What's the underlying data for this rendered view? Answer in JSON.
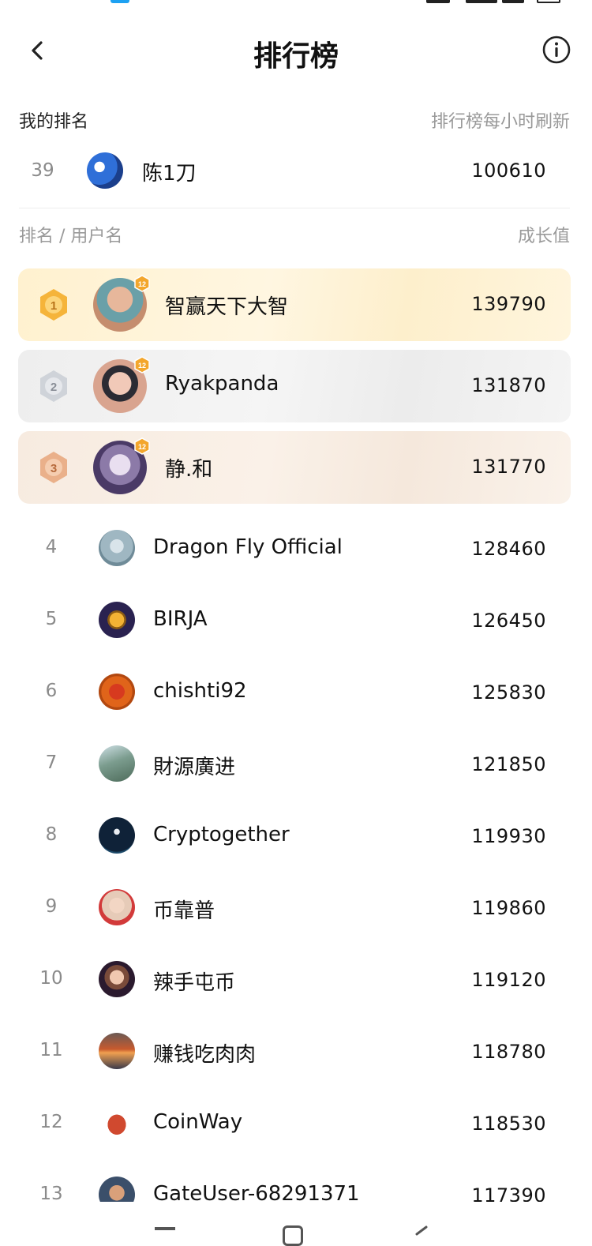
{
  "header": {
    "title": "排行榜"
  },
  "my_rank": {
    "label": "我的排名",
    "refresh_note": "排行榜每小时刷新",
    "rank": "39",
    "name": "陈1刀",
    "score": "100610",
    "avatar_color": "#2f6fd8"
  },
  "columns": {
    "left": "排名 / 用户名",
    "right": "成长值"
  },
  "top3": [
    {
      "rank": "1",
      "name": "智赢天下大智",
      "score": "139790",
      "level": "12",
      "medal_color": "#f5b43a",
      "avatar_color": "#c58d6e"
    },
    {
      "rank": "2",
      "name": "Ryakpanda",
      "score": "131870",
      "level": "12",
      "medal_color": "#bfc4cc",
      "avatar_color": "#d9a48f"
    },
    {
      "rank": "3",
      "name": "静.和",
      "score": "131770",
      "level": "12",
      "medal_color": "#e5a57b",
      "avatar_color": "#5e4a7a"
    }
  ],
  "list": [
    {
      "rank": "4",
      "name": "Dragon Fly Official",
      "score": "128460",
      "avatar_color": "#9fb7c2"
    },
    {
      "rank": "5",
      "name": "BIRJA",
      "score": "126450",
      "avatar_color": "#2a2250"
    },
    {
      "rank": "6",
      "name": "chishti92",
      "score": "125830",
      "avatar_color": "#e0641a"
    },
    {
      "rank": "7",
      "name": "財源廣进",
      "score": "121850",
      "avatar_color": "#7b9c8e"
    },
    {
      "rank": "8",
      "name": "Cryptogether",
      "score": "119930",
      "avatar_color": "#0f2238"
    },
    {
      "rank": "9",
      "name": "币靠普",
      "score": "119860",
      "avatar_color": "#e6cbb8"
    },
    {
      "rank": "10",
      "name": "辣手屯币",
      "score": "119120",
      "avatar_color": "#2b1a2e"
    },
    {
      "rank": "11",
      "name": "赚钱吃肉肉",
      "score": "118780",
      "avatar_color": "#a25a45"
    },
    {
      "rank": "12",
      "name": "CoinWay",
      "score": "118530",
      "avatar_color": "#d0492f"
    },
    {
      "rank": "13",
      "name": "GateUser-68291371",
      "score": "117390",
      "avatar_color": "#3b4f6a"
    }
  ],
  "icons": {
    "back": "chevron-left-icon",
    "info": "info-circle-icon",
    "level_badge": "level-badge-icon",
    "medal": "medal-icon"
  }
}
